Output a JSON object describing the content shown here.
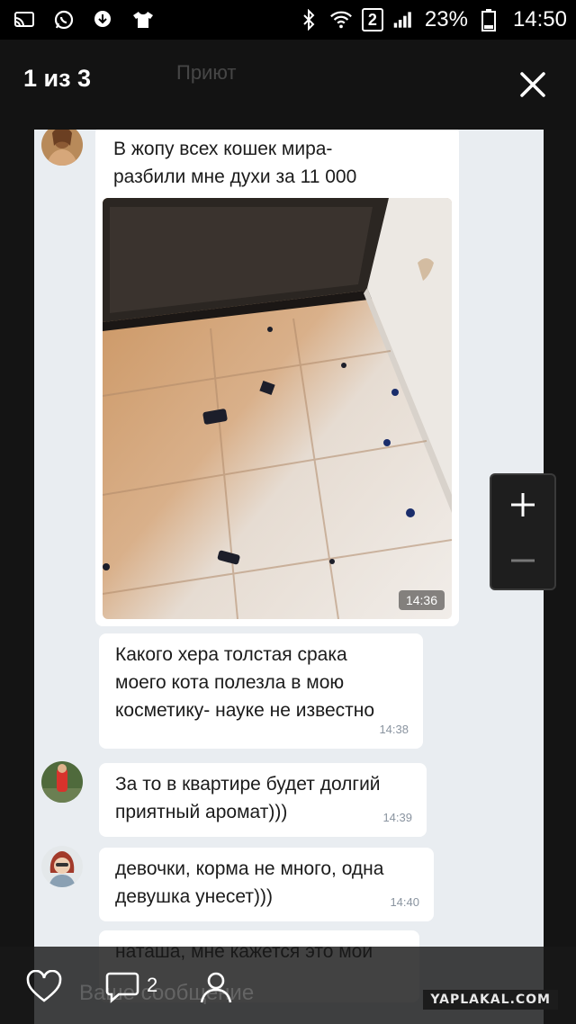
{
  "statusbar": {
    "battery": "23%",
    "time": "14:50",
    "sim": "2",
    "icons": [
      "cast-icon",
      "whatsapp-icon",
      "download-icon",
      "tshirt-icon",
      "bluetooth-icon",
      "wifi-icon",
      "signal-icon",
      "battery-icon"
    ]
  },
  "viewer": {
    "counter": "1 из 3",
    "ghost_title": "Приют"
  },
  "chat": {
    "messages": [
      {
        "text": "В жопу всех кошек мира-\nразбили мне духи за 11 000",
        "time": ""
      },
      {
        "text": "",
        "time": "14:36"
      },
      {
        "text": "Какого хера толстая срака\nмоего кота полезла в мою\nкосметику- науке не известно",
        "time": "14:38"
      },
      {
        "text": "За то в квартире будет долгий\nприятный аромат)))",
        "time": "14:39"
      },
      {
        "text": "девочки, корма не много, одна\nдевушка унесет)))",
        "time": "14:40"
      },
      {
        "text": "наташа, мне кажется это мои",
        "time": ""
      }
    ]
  },
  "bottom": {
    "comments_count": "2",
    "ghost_input": "Ваше сообщение",
    "watermark": "YAPLAKAL.COM"
  },
  "colors": {
    "chat_bg": "#e9edf1",
    "bubble_bg": "#ffffff",
    "timestamp": "#8a94a0"
  }
}
